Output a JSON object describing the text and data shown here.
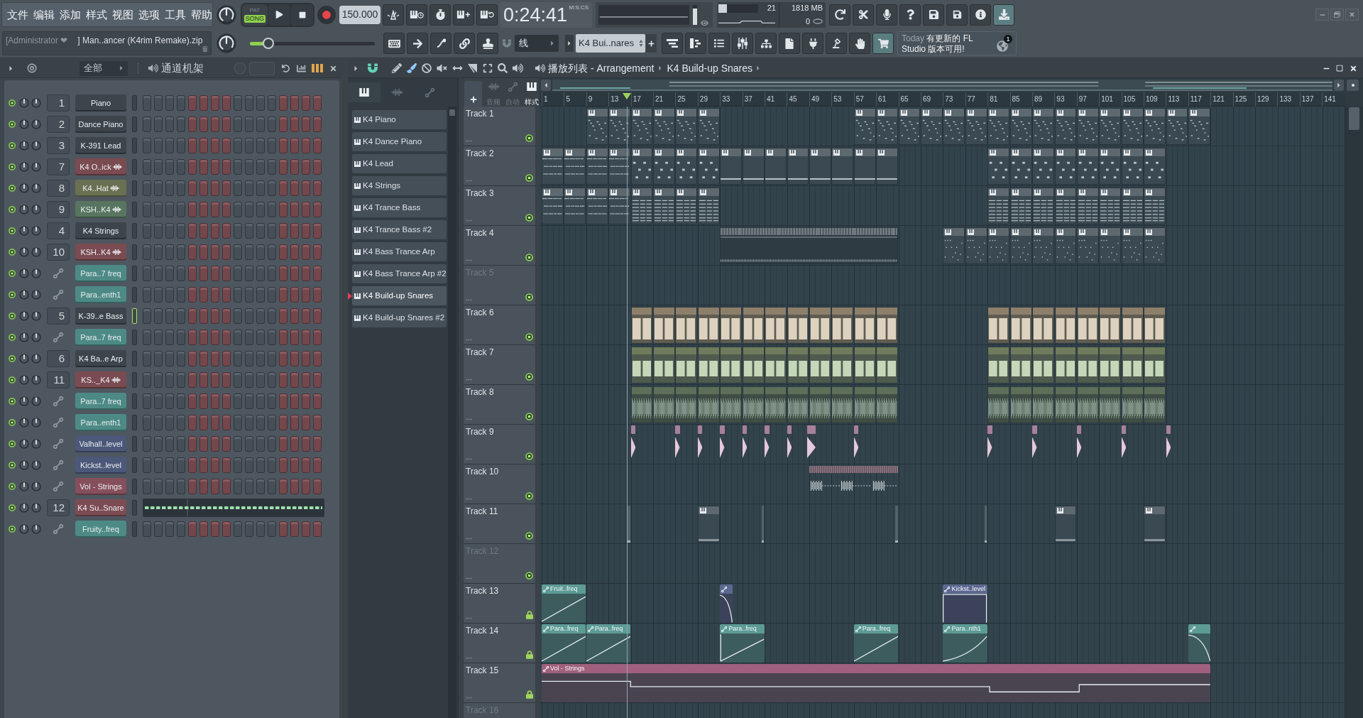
{
  "menu": [
    "文件",
    "编辑",
    "添加",
    "样式",
    "视图",
    "选项",
    "工具",
    "帮助"
  ],
  "transport": {
    "modes": [
      {
        "label": "PAT",
        "selected": false
      },
      {
        "label": "SONG",
        "selected": true
      }
    ],
    "tempo": "150.000",
    "time": "0:24:41",
    "time_format": "M:S:CS"
  },
  "monitor": {
    "output_volume": {
      "level": 0.8
    },
    "cpu_meter": {
      "level": 0.22
    },
    "cpu": "21",
    "memory": "1818 MB",
    "polyphony": "0"
  },
  "hint_bar": {
    "user": "[Administrator ❤",
    "file": "] Man..ancer (K4rim Remake).zip"
  },
  "master_pitch": {
    "level": 0.15
  },
  "snap": "线",
  "pattern_selector": "K4 Bui..nares",
  "news": {
    "date": "Today",
    "message": "有更新的 FL Studio 版本可用!",
    "badge": "1"
  },
  "channel_rack": {
    "filter": "全部",
    "title": "通道机架",
    "channels": [
      {
        "name": "Piano",
        "mixer": "1",
        "kind": "instrument",
        "color": "#3d444c",
        "on": true,
        "selected": false
      },
      {
        "name": "Dance Piano",
        "mixer": "2",
        "kind": "instrument",
        "color": "#3d444c",
        "on": true,
        "selected": false
      },
      {
        "name": "K-391 Lead",
        "mixer": "3",
        "kind": "instrument",
        "color": "#3d444c",
        "on": true,
        "selected": false
      },
      {
        "name": "K4 O..ick",
        "mixer": "7",
        "kind": "sample",
        "color": "#7a4b51",
        "on": true,
        "selected": false
      },
      {
        "name": "K4..Hat",
        "mixer": "8",
        "kind": "sample",
        "color": "#6a7152",
        "on": true,
        "selected": false
      },
      {
        "name": "KSH..K4",
        "mixer": "9",
        "kind": "sample",
        "color": "#587560",
        "on": true,
        "selected": false
      },
      {
        "name": "K4 Strings",
        "mixer": "4",
        "kind": "instrument",
        "color": "#3d444c",
        "on": true,
        "selected": false
      },
      {
        "name": "KSH..K4",
        "mixer": "10",
        "kind": "sample",
        "color": "#7a4b51",
        "on": true,
        "selected": false
      },
      {
        "name": "Para..7 freq",
        "kind": "automation",
        "color": "#4d8a86",
        "on": true,
        "selected": false
      },
      {
        "name": "Para..enth1",
        "kind": "automation",
        "color": "#4d8a86",
        "on": true,
        "selected": false
      },
      {
        "name": "K-39..e Bass",
        "mixer": "5",
        "kind": "instrument",
        "color": "#3d444c",
        "on": true,
        "selected": true
      },
      {
        "name": "Para..7 freq",
        "kind": "automation",
        "color": "#4d8a86",
        "on": true,
        "selected": false
      },
      {
        "name": "K4 Ba..e Arp",
        "mixer": "6",
        "kind": "instrument",
        "color": "#3d444c",
        "on": true,
        "selected": false
      },
      {
        "name": "KS.._K4",
        "mixer": "11",
        "kind": "sample",
        "color": "#7a4b51",
        "on": true,
        "selected": false
      },
      {
        "name": "Para..7 freq",
        "kind": "automation",
        "color": "#4d8a86",
        "on": true,
        "selected": false
      },
      {
        "name": "Para..enth1",
        "kind": "automation",
        "color": "#4d8a86",
        "on": true,
        "selected": false
      },
      {
        "name": "Valhall..level",
        "kind": "automation",
        "color": "#4c5879",
        "on": true,
        "selected": false
      },
      {
        "name": "Kickst..level",
        "kind": "automation",
        "color": "#4c5879",
        "on": true,
        "selected": false
      },
      {
        "name": "Vol - Strings",
        "kind": "automation",
        "color": "#864f5c",
        "on": true,
        "selected": false
      },
      {
        "name": "K4 Su..Snare",
        "mixer": "12",
        "kind": "pianoroll",
        "color": "#7d4c53",
        "on": true,
        "selected": false
      },
      {
        "name": "Fruity..freq",
        "kind": "automation",
        "color": "#4d8a86",
        "on": true,
        "selected": false
      }
    ]
  },
  "playlist": {
    "title": "播放列表 - Arrangement",
    "breadcrumb": "K4 Build-up Snares",
    "picker_tabs": [
      {
        "kind": "patterns",
        "selected": true
      },
      {
        "kind": "audio",
        "selected": false
      },
      {
        "kind": "automation",
        "selected": false
      }
    ],
    "patterns": [
      {
        "name": "K4 Piano",
        "selected": false
      },
      {
        "name": "K4 Dance Piano",
        "selected": false
      },
      {
        "name": "K4 Lead",
        "selected": false
      },
      {
        "name": "K4 Strings",
        "selected": false
      },
      {
        "name": "K4 Trance Bass",
        "selected": false
      },
      {
        "name": "K4 Trance Bass #2",
        "selected": false
      },
      {
        "name": "K4 Bass Trance Arp",
        "selected": false
      },
      {
        "name": "K4 Bass Trance Arp #2",
        "selected": false
      },
      {
        "name": "K4 Build-up Snares",
        "selected": true
      },
      {
        "name": "K4 Build-up Snares #2",
        "selected": false
      }
    ],
    "filters": [
      {
        "kind": "audio",
        "label": "音频",
        "selected": false
      },
      {
        "kind": "automation",
        "label": "自动",
        "selected": false
      },
      {
        "kind": "patterns",
        "label": "样式",
        "selected": true
      }
    ],
    "ruler": [
      "1",
      "5",
      "9",
      "13",
      "17",
      "21",
      "25",
      "29",
      "33",
      "37",
      "41",
      "45",
      "49",
      "53",
      "57",
      "61",
      "65",
      "69",
      "73",
      "77",
      "81",
      "85",
      "89",
      "93",
      "97",
      "101",
      "105",
      "109",
      "113",
      "117",
      "121",
      "125",
      "129",
      "133",
      "137",
      "141"
    ],
    "playhead": {
      "level": 0.106
    },
    "tracks": [
      {
        "name": "Track 1",
        "dimmed": false,
        "locked": false
      },
      {
        "name": "Track 2",
        "dimmed": false,
        "locked": false
      },
      {
        "name": "Track 3",
        "dimmed": false,
        "locked": false
      },
      {
        "name": "Track 4",
        "dimmed": false,
        "locked": false
      },
      {
        "name": "Track 5",
        "dimmed": true,
        "locked": false
      },
      {
        "name": "Track 6",
        "dimmed": false,
        "locked": false
      },
      {
        "name": "Track 7",
        "dimmed": false,
        "locked": false
      },
      {
        "name": "Track 8",
        "dimmed": false,
        "locked": false
      },
      {
        "name": "Track 9",
        "dimmed": false,
        "locked": false
      },
      {
        "name": "Track 10",
        "dimmed": false,
        "locked": false
      },
      {
        "name": "Track 11",
        "dimmed": false,
        "locked": false
      },
      {
        "name": "Track 12",
        "dimmed": true,
        "locked": false
      },
      {
        "name": "Track 13",
        "dimmed": false,
        "locked": true,
        "clip_labels": [
          "Fruit..freq",
          "Kickst..level"
        ]
      },
      {
        "name": "Track 14",
        "dimmed": false,
        "locked": true,
        "clip_labels": [
          "Para..freq",
          "Para..freq",
          "Para..freq",
          "Para..freq",
          "Para..nth1"
        ]
      },
      {
        "name": "Track 15",
        "dimmed": false,
        "locked": true,
        "clip_labels": [
          "Vol - Strings"
        ]
      },
      {
        "name": "Track 16",
        "dimmed": true
      }
    ]
  }
}
